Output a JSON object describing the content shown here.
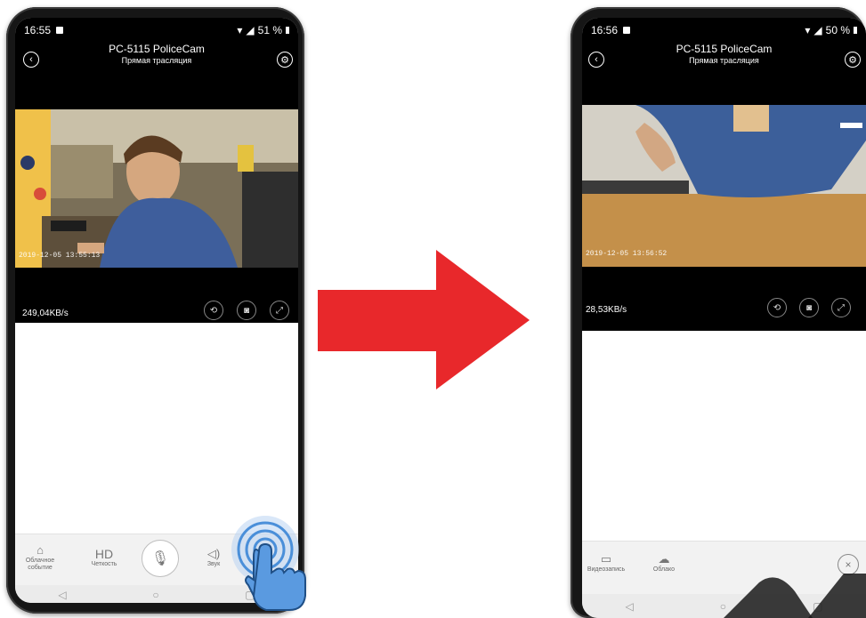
{
  "left_phone": {
    "status_time": "16:55",
    "battery": "51 %",
    "title": "PC-5115 PoliceCam",
    "subtitle": "Прямая трасляция",
    "video_timestamp": "2019-12-05 13:55:13",
    "speed": "249,04KB/s",
    "toolbar": {
      "cloud_event": "Облачное событие",
      "hd_icon": "HD",
      "quality": "Четкость",
      "sound": "Звук"
    }
  },
  "right_phone": {
    "status_time": "16:56",
    "battery": "50 %",
    "title": "PC-5115 PoliceCam",
    "subtitle": "Прямая трасляция",
    "video_timestamp": "2019-12-05 13:56:52",
    "speed": "28,53KB/s",
    "toolbar": {
      "video_record": "Видеозапись",
      "cloud": "Облако"
    }
  },
  "colors": {
    "arrow": "#e8282b",
    "hand": "#4a8fd9"
  },
  "icons": [
    "back-icon",
    "settings-icon",
    "replay-icon",
    "camera-icon",
    "fullscreen-icon",
    "cloud-event-icon",
    "microphone-icon",
    "sound-icon",
    "video-record-icon",
    "cloud-icon",
    "close-icon",
    "nav-back-icon",
    "nav-home-icon",
    "nav-recent-icon",
    "pointing-hand-icon",
    "right-arrow-icon"
  ]
}
